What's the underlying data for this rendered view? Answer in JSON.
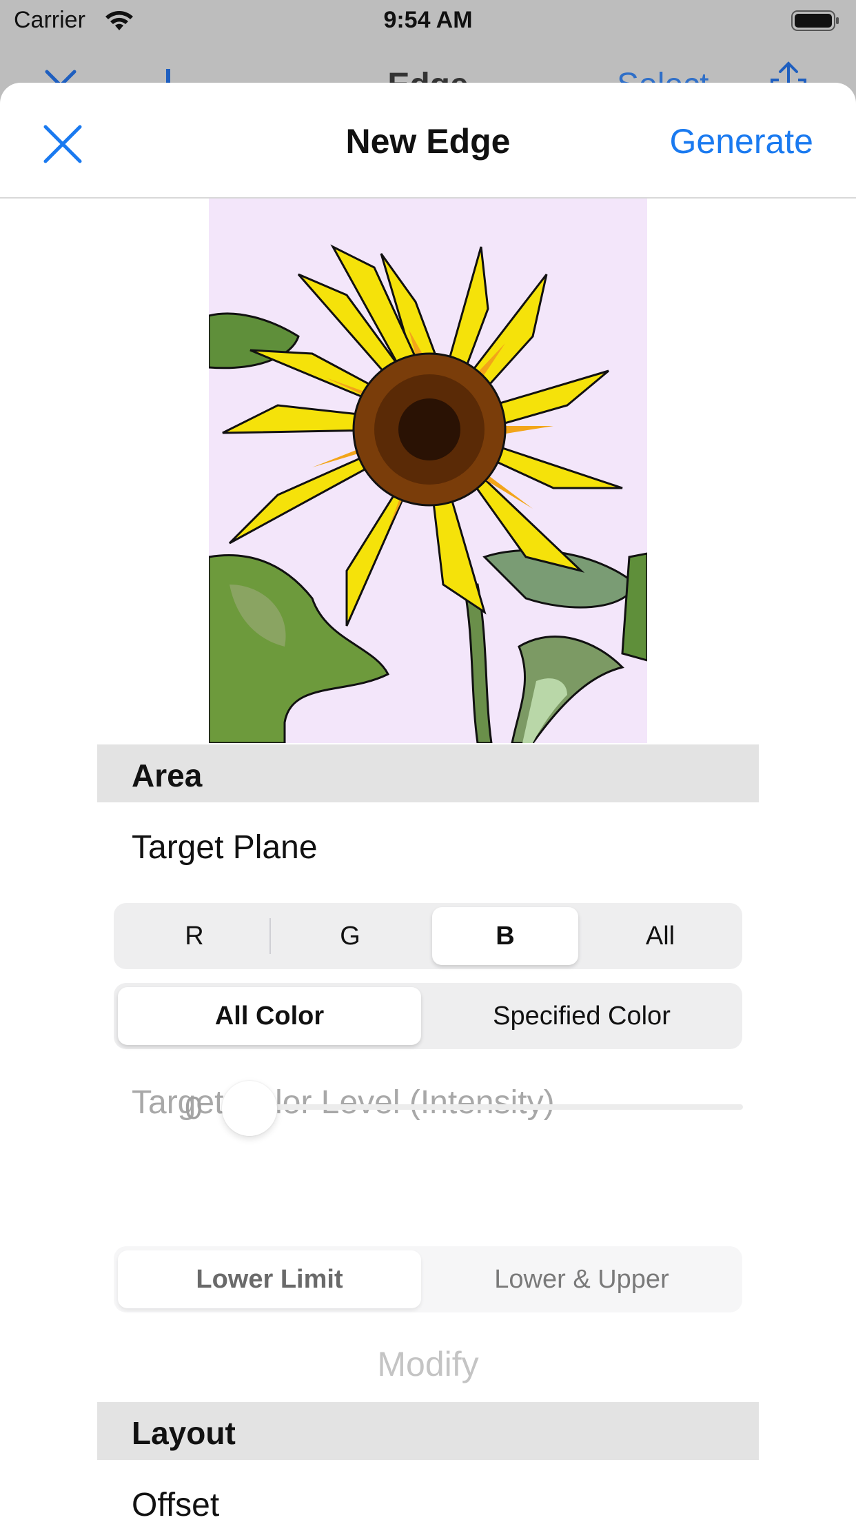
{
  "status_bar": {
    "carrier": "Carrier",
    "time": "9:54 AM"
  },
  "underlying_nav": {
    "title": "Edge",
    "select_label": "Select"
  },
  "sheet": {
    "title": "New Edge",
    "generate_label": "Generate",
    "close_icon": "close-icon"
  },
  "area_section": {
    "header": "Area",
    "target_plane_label": "Target Plane",
    "plane_segments": [
      "R",
      "G",
      "B",
      "All"
    ],
    "plane_selected": "B",
    "color_mode_segments": [
      "All Color",
      "Specified Color"
    ],
    "color_mode_selected": "All Color",
    "level_label": "Target Color Level (Intensity)",
    "level_value": "0",
    "limit_segments": [
      "Lower Limit",
      "Lower & Upper"
    ],
    "limit_selected": "Lower Limit",
    "modify_label": "Modify"
  },
  "layout_section": {
    "header": "Layout",
    "offset_label": "Offset"
  },
  "colors": {
    "accent": "#1a7af0",
    "preview_background": "#f3e6fa",
    "section_header": "#e3e3e3"
  }
}
